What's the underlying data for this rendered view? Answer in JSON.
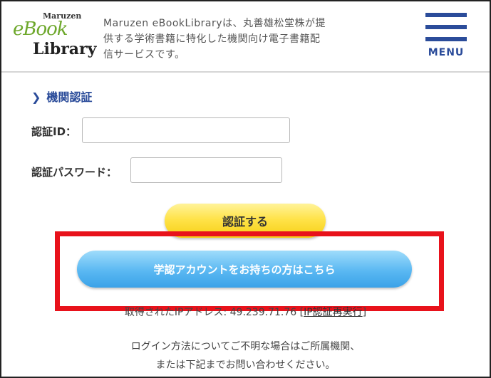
{
  "header": {
    "logo": {
      "top": "Maruzen",
      "mid": "eBook",
      "bottom": "Library"
    },
    "description_lines": [
      "Maruzen eBookLibraryは、丸善雄松堂株が提",
      "供する学術書籍に特化した機関向け電子書籍配",
      "信サービスです。"
    ],
    "menu_label": "MENU"
  },
  "section": {
    "title": "機関認証",
    "id_label": "認証ID：",
    "id_value": "",
    "password_label": "認証パスワード：",
    "password_value": "",
    "auth_button": "認証する",
    "gakunin_button": "学認アカウントをお持ちの方はこちら"
  },
  "ip": {
    "prefix": "取得されたIPアドレス: 49.239.71.76 [",
    "link": "IP認証再実行",
    "suffix": "]"
  },
  "help": {
    "line1": "ログイン方法についてご不明な場合はご所属機関、",
    "line2": "または下記までお問い合わせください。"
  },
  "colors": {
    "accent": "#2b4c9a",
    "highlight": "#e8121b",
    "auth_button": "#ffe34a",
    "gakunin_button": "#5ab8f2"
  }
}
